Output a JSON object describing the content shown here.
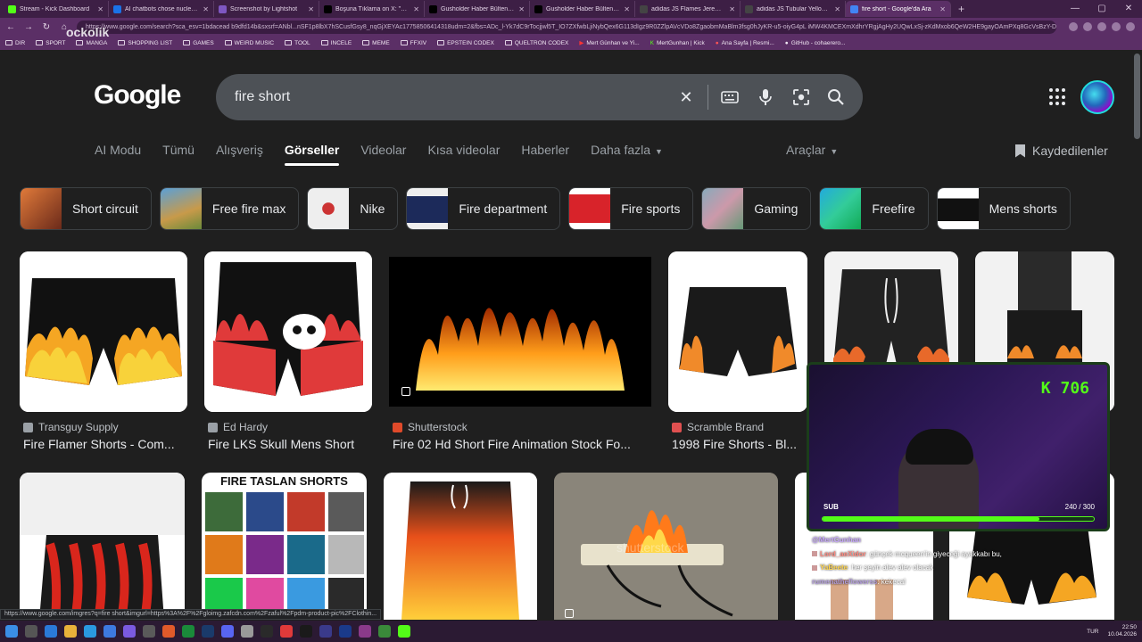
{
  "browser": {
    "tabs": [
      {
        "title": "Stream - Kick Dashboard",
        "color": "#53fc18"
      },
      {
        "title": "AI chatbots chose nuclear escalati",
        "color": "#1a73e8"
      },
      {
        "title": "Screenshot by Lightshot",
        "color": "#7e57c2"
      },
      {
        "title": "Boşuna Tıklama on X: \"Trump, uça",
        "color": "#000000"
      },
      {
        "title": "Gusholder Haber Bülteni on X: \"#",
        "color": "#000000"
      },
      {
        "title": "Gusholder Haber Bülteni on X: \"#",
        "color": "#000000"
      },
      {
        "title": "adidas JS Flames Jeremy Scott Me",
        "color": "#444444"
      },
      {
        "title": "adidas JS Tubular Yellow Green M",
        "color": "#444444"
      },
      {
        "title": "fire short - Google'da Ara",
        "color": "#4285f4",
        "active": true
      }
    ],
    "new_tab": "+",
    "window_controls": [
      "—",
      "▢",
      "✕"
    ],
    "url": "https://www.google.com/search?sca_esv=1bdacead b9dfd14b&sxsrf=ANbl...nSF1p8lbX7hSCusfGsy8_nqGjXEYAc17758506414318udm=2&fbs=ADc_l-Yk7dC9rTocjjwl5T_IO7ZXfwbLjiNybQex6G113dIgz9R0ZZlpAVcVDo8ZgaobmMaBlm3fsg0hJyKR-u5-oiyG4pL iMW4KMCEXmXdhrYRgjAgHy2UQwLxSj-zKdMxob6QeW2HE9gayOAmPXq8GcVsBzY-DQ5HFz9",
    "bookmarks": [
      "DIR",
      "SPORT",
      "MANGA",
      "SHOPPING LIST",
      "GAMES",
      "WEIRD MUSIC",
      "TOOL",
      "INCELE",
      "MEME",
      "FFXIV",
      "EPSTEIN CODEX",
      "QUELTRON CODEX",
      "Mert Günhan ve Yi...",
      "MertGunhan | Kick",
      "Ana Sayfa | Resmi...",
      "GitHub - cohaerero..."
    ]
  },
  "watermark": "ockolik",
  "google": {
    "logo": "Google",
    "query": "fire short",
    "nav_tabs": [
      "AI Modu",
      "Tümü",
      "Alışveriş",
      "Görseller",
      "Videolar",
      "Kısa videolar",
      "Haberler",
      "Daha fazla"
    ],
    "active_tab": "Görseller",
    "tools": "Araçlar",
    "saved": "Kaydedilenler",
    "chips": [
      {
        "label": "Short circuit",
        "color": "#b5543a"
      },
      {
        "label": "Free fire max",
        "color": "#7b9b3a"
      },
      {
        "label": "Nike",
        "color": "#e8e8e8"
      },
      {
        "label": "Fire department",
        "color": "#1c2a5a"
      },
      {
        "label": "Fire sports",
        "color": "#d8232a"
      },
      {
        "label": "Gaming",
        "color": "#6b8e9b"
      },
      {
        "label": "Freefire",
        "color": "#2aa6a0"
      },
      {
        "label": "Mens shorts",
        "color": "#eaeaea"
      }
    ],
    "results_row1": [
      {
        "source": "Transguy Supply",
        "title": "Fire Flamer Shorts - Com..."
      },
      {
        "source": "Ed Hardy",
        "title": "Fire LKS Skull Mens Short"
      },
      {
        "source": "Shutterstock",
        "title": "Fire 02 Hd Short Fire Animation Stock Fo..."
      },
      {
        "source": "Scramble Brand",
        "title": "1998 Fire Shorts - Bl..."
      },
      {
        "source": "",
        "title": ""
      },
      {
        "source": "",
        "title": ""
      }
    ],
    "results_row2_banner": "FIRE TASLAN SHORTS",
    "shutterstock_watermark": "shutterstock"
  },
  "stream": {
    "kick_count": "706",
    "sub_label": "SUB",
    "sub_progress": "240 / 300",
    "sub_fraction": 0.8,
    "chat": [
      {
        "user": "@MertGunhan",
        "text": "",
        "color": "#c8a8ff"
      },
      {
        "user": "Lord_aeXidor",
        "text": ": günçek mcqueen'in giyeceği ayakkabı bu,",
        "color": "#ff8a80"
      },
      {
        "user": "YaBeete",
        "text": ": her şeyin alev alev olacak",
        "color": "#ffd54f"
      },
      {
        "user": "rumenatheflowerss",
        "text": ": kekecal",
        "color": "#b39ddb"
      }
    ]
  },
  "status_url": "https://www.google.com/imgres?q=fire short&imgurl=https%3A%2F%2Fgloimg.zafcdn.com%2Fzaful%2Fpdm-product-pic%2FClothin...",
  "taskbar": {
    "lang": "TUR",
    "time": "22:50",
    "date": "10.04.2026"
  }
}
